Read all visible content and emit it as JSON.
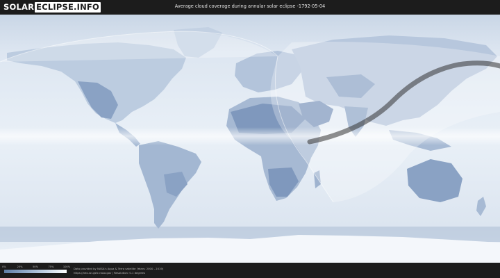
{
  "header": {
    "logo_part1": "SOLAR",
    "logo_part2": "ECLIPSE.INFO",
    "title": "Average cloud coverage during annular solar eclipse -1792-05-04"
  },
  "legend": {
    "ticks": [
      "0%",
      "25%",
      "50%",
      "75%",
      "100%"
    ],
    "colors": [
      "#5f7ea6",
      "#8fa9c8",
      "#c4d4e6",
      "#ffffff"
    ]
  },
  "credits": {
    "line1": "Data provided by NASA's Aqua & Terra satellite (Years: 2000 - 2019)",
    "line2": "https://neo.sci.gsfc.nasa.gov | Resolution: 0.1 degrees"
  },
  "colors": {
    "ocean": "#e4ecf5",
    "land_clear": "#7f98bd",
    "land_mid": "#a8bcd6",
    "band": "#f6f9fc",
    "eclipse_region": "#ffffff",
    "central_path": "#333333"
  }
}
